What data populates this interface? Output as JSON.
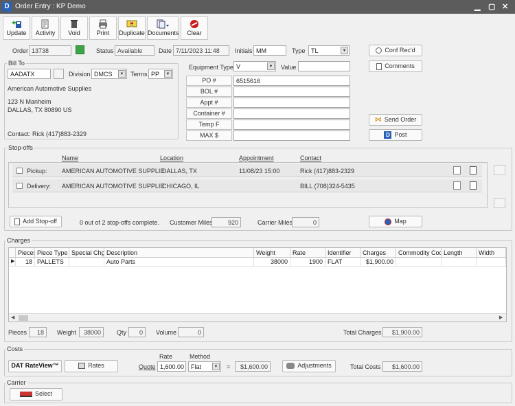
{
  "window": {
    "logo": "D",
    "title": "Order Entry :  KP Demo",
    "min": "▁",
    "max": "▢",
    "close": "✕"
  },
  "toolbar": {
    "update": "Update",
    "activity": "Activity",
    "void": "Void",
    "print": "Print",
    "duplicate": "Duplicate",
    "documents": "Documents",
    "clear": "Clear"
  },
  "header": {
    "order_label": "Order",
    "order": "13738",
    "status_label": "Status",
    "status": "Available",
    "date_label": "Date",
    "date": "7/11/2023 11:48",
    "initials_label": "Initials",
    "initials": "MM",
    "type_label": "Type",
    "type": "TL"
  },
  "bill_to": {
    "title": "Bill To",
    "code": "AADATX",
    "division_label": "Division",
    "division": "DMCS",
    "terms_label": "Terms",
    "terms": "PP",
    "name": "American Automotive Supplies",
    "address1": "123 N Manheim",
    "address2": "DALLAS, TX  80890  US",
    "contact": "Contact: Rick  (417)883-2329"
  },
  "equipment": {
    "type_label": "Equipment Type",
    "type": "V",
    "value_label": "Value",
    "value": "",
    "po_label": "PO #",
    "po": "6515616",
    "bol_label": "BOL #",
    "bol": "",
    "appt_label": "Appt #",
    "appt": "",
    "container_label": "Container #",
    "container": "",
    "temp_label": "Temp F",
    "temp": "",
    "max_label": "MAX  $",
    "max": ""
  },
  "side_buttons": {
    "conf": "Conf Rec'd",
    "comments": "Comments",
    "send_order": "Send Order",
    "post": "Post"
  },
  "stopoffs": {
    "title": "Stop-offs",
    "col_name": "Name",
    "col_location": "Location",
    "col_appt": "Appointment",
    "col_contact": "Contact",
    "rows": [
      {
        "type": "Pickup:",
        "name": "AMERICAN AUTOMOTIVE SUPPLIE",
        "location": "DALLAS, TX",
        "appt": "11/08/23 15:00",
        "contact": "Rick  (417)883-2329"
      },
      {
        "type": "Delivery:",
        "name": "AMERICAN AUTOMOTIVE SUPPLIE",
        "location": "CHICAGO, IL",
        "appt": "",
        "contact": "BILL  (708)324-5435"
      }
    ],
    "add_stop": "Add Stop-off",
    "complete_text": "0 out of 2 stop-offs complete.",
    "customer_miles_label": "Customer Miles",
    "customer_miles": "920",
    "carrier_miles_label": "Carrier Miles",
    "carrier_miles": "0",
    "map": "Map"
  },
  "charges": {
    "title": "Charges",
    "columns": [
      "Pieces",
      "Piece Type",
      "Special Chg",
      "Description",
      "Weight",
      "Rate",
      "Identifier",
      "Charges",
      "Commodity Code",
      "Length",
      "Width"
    ],
    "row": {
      "pieces": "18",
      "piece_type": "PALLETS",
      "special": "",
      "description": "Auto Parts",
      "weight": "38000",
      "rate": "1900",
      "identifier": "FLAT",
      "charges": "$1,900.00",
      "commodity": "",
      "length": "",
      "width": ""
    },
    "pieces_label": "Pieces",
    "pieces": "18",
    "weight_label": "Weight",
    "weight": "38000",
    "qty_label": "Qty",
    "qty": "0",
    "volume_label": "Volume",
    "volume": "0",
    "total_label": "Total Charges",
    "total": "$1,900.00"
  },
  "costs": {
    "title": "Costs",
    "rateview": "DAT RateView™",
    "rates": "Rates",
    "rate_label": "Rate",
    "method_label": "Method",
    "quote_label": "Quote",
    "quote": "1,600.00",
    "method": "Flat",
    "eq": "=",
    "amount": "$1,600.00",
    "adjustments": "Adjustments",
    "total_label": "Total Costs",
    "total": "$1,600.00"
  },
  "carrier": {
    "title": "Carrier",
    "select": "Select"
  }
}
